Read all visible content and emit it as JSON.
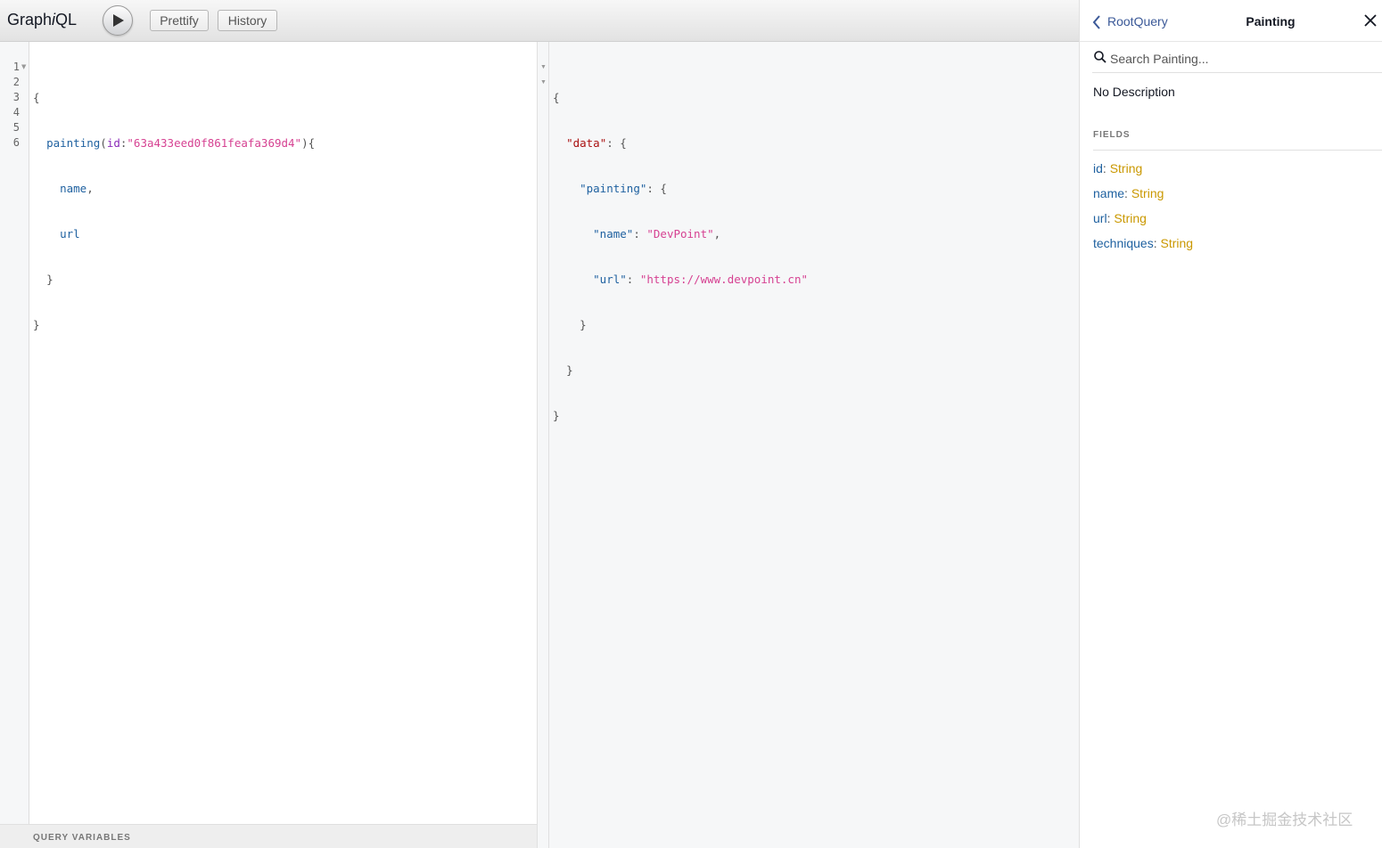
{
  "toolbar": {
    "logo_pre": "Graph",
    "logo_italic": "i",
    "logo_post": "QL",
    "prettify_label": "Prettify",
    "history_label": "History"
  },
  "editor": {
    "line_numbers": [
      "1",
      "2",
      "3",
      "4",
      "5",
      "6"
    ],
    "lines": {
      "l1": "{",
      "l2_field": "painting",
      "l2_paren_open": "(",
      "l2_attr": "id",
      "l2_colon": ":",
      "l2_value": "\"63a433eed0f861feafa369d4\"",
      "l2_paren_close": "){",
      "l3_field": "name",
      "l3_punct": ",",
      "l4_field": "url",
      "l5": "}",
      "l6": "}"
    },
    "variables_title": "QUERY VARIABLES"
  },
  "result": {
    "l1": "{",
    "data_key": "\"data\"",
    "data_punct": ": {",
    "painting_key": "\"painting\"",
    "painting_punct": ": {",
    "name_key": "\"name\"",
    "name_sep": ": ",
    "name_value": "\"DevPoint\"",
    "name_comma": ",",
    "url_key": "\"url\"",
    "url_sep": ": ",
    "url_value": "\"https://www.devpoint.cn\"",
    "close_inner": "}",
    "close_mid": "}",
    "close_outer": "}"
  },
  "docs": {
    "back_label": "RootQuery",
    "title": "Painting",
    "search_placeholder": "Search Painting...",
    "description": "No Description",
    "fields_title": "FIELDS",
    "fields": [
      {
        "name": "id",
        "type": "String"
      },
      {
        "name": "name",
        "type": "String"
      },
      {
        "name": "url",
        "type": "String"
      },
      {
        "name": "techniques",
        "type": "String"
      }
    ]
  },
  "watermark": "@稀土掘金技术社区",
  "colors": {
    "field": "#1f61a0",
    "string": "#d64292",
    "type": "#ca9800",
    "link": "#3b5998"
  },
  "icons": {
    "run": "play-icon",
    "back": "chevron-left-icon",
    "close": "close-icon",
    "search": "search-icon",
    "fold": "fold-arrow-icon"
  }
}
